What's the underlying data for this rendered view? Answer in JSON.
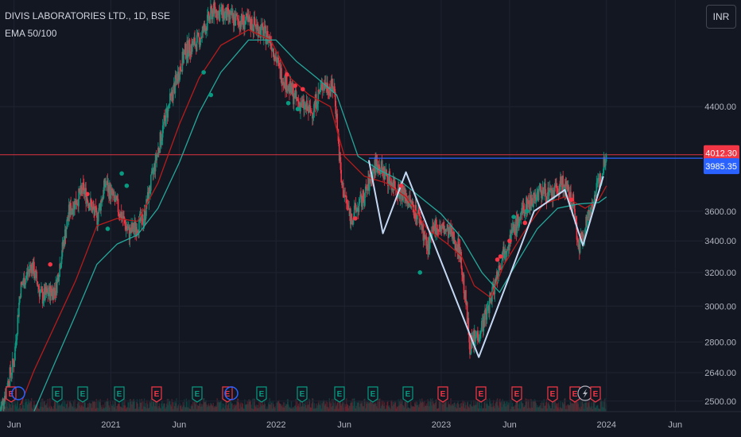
{
  "header": {
    "title": "DIVIS LABORATORIES LTD., 1D, BSE",
    "indicator": "EMA 50/100"
  },
  "currency": "INR",
  "price_labels": {
    "last": "4012.30",
    "level": "3985.35",
    "last_color": "#f23645",
    "level_color": "#2962ff"
  },
  "colors": {
    "up": "#089981",
    "down": "#f23645",
    "ema50": "#b71c1c",
    "ema100": "#26a69a",
    "pattern": "#c5d8f3",
    "level": "#2962ff"
  },
  "event_markers": [
    {
      "type": "E",
      "color": "#f23645"
    },
    {
      "type": "dividend",
      "color": "#2962ff"
    },
    {
      "type": "E",
      "color": "#089981"
    },
    {
      "type": "E",
      "color": "#089981"
    },
    {
      "type": "E",
      "color": "#089981"
    },
    {
      "type": "E",
      "color": "#f23645"
    },
    {
      "type": "E",
      "color": "#089981"
    },
    {
      "type": "E",
      "color": "#f23645"
    },
    {
      "type": "dividend",
      "color": "#2962ff"
    },
    {
      "type": "E",
      "color": "#089981"
    },
    {
      "type": "E",
      "color": "#089981"
    },
    {
      "type": "E",
      "color": "#089981"
    },
    {
      "type": "E",
      "color": "#089981"
    },
    {
      "type": "E",
      "color": "#089981"
    },
    {
      "type": "E",
      "color": "#f23645"
    },
    {
      "type": "E",
      "color": "#f23645"
    },
    {
      "type": "E",
      "color": "#f23645"
    },
    {
      "type": "E",
      "color": "#f23645"
    },
    {
      "type": "E",
      "color": "#f23645"
    },
    {
      "type": "flash",
      "color": "#b2b5be"
    },
    {
      "type": "E",
      "color": "#f23645"
    }
  ],
  "chart_data": {
    "type": "line",
    "subtype": "candlestick",
    "title": "DIVIS LABORATORIES LTD., 1D, BSE",
    "y_scale": "log",
    "y_range": [
      2450,
      5400
    ],
    "y_ticks": [
      "4400.00",
      "3600.00",
      "3400.00",
      "3200.00",
      "3000.00",
      "2800.00",
      "2640.00",
      "2500.00"
    ],
    "x_range": [
      "2020-05-01",
      "2024-08-01"
    ],
    "x_ticks": [
      {
        "label": "Jun",
        "date": "2020-06-01"
      },
      {
        "label": "2021",
        "date": "2021-01-01"
      },
      {
        "label": "Jun",
        "date": "2021-06-01"
      },
      {
        "label": "2022",
        "date": "2022-01-01"
      },
      {
        "label": "Jun",
        "date": "2022-06-01"
      },
      {
        "label": "2023",
        "date": "2023-01-01"
      },
      {
        "label": "Jun",
        "date": "2023-06-01"
      },
      {
        "label": "2024",
        "date": "2024-01-01"
      },
      {
        "label": "Jun",
        "date": "2024-06-01"
      }
    ],
    "price_path": [
      [
        "2020-05-01",
        2450
      ],
      [
        "2020-06-01",
        2700
      ],
      [
        "2020-06-15",
        3100
      ],
      [
        "2020-07-10",
        3250
      ],
      [
        "2020-08-01",
        3050
      ],
      [
        "2020-09-01",
        3100
      ],
      [
        "2020-10-01",
        3600
      ],
      [
        "2020-11-01",
        3750
      ],
      [
        "2020-12-01",
        3550
      ],
      [
        "2020-12-20",
        3800
      ],
      [
        "2021-01-20",
        3600
      ],
      [
        "2021-02-10",
        3450
      ],
      [
        "2021-03-15",
        3550
      ],
      [
        "2021-05-01",
        4300
      ],
      [
        "2021-06-15",
        4900
      ],
      [
        "2021-07-15",
        5000
      ],
      [
        "2021-08-15",
        5300
      ],
      [
        "2021-10-01",
        5200
      ],
      [
        "2021-11-15",
        5150
      ],
      [
        "2021-12-20",
        5000
      ],
      [
        "2022-01-10",
        4700
      ],
      [
        "2022-02-15",
        4450
      ],
      [
        "2022-03-20",
        4350
      ],
      [
        "2022-04-15",
        4600
      ],
      [
        "2022-05-10",
        4550
      ],
      [
        "2022-05-25",
        3800
      ],
      [
        "2022-06-15",
        3550
      ],
      [
        "2022-07-15",
        3700
      ],
      [
        "2022-08-10",
        3950
      ],
      [
        "2022-09-15",
        3800
      ],
      [
        "2022-10-15",
        3700
      ],
      [
        "2022-11-15",
        3550
      ],
      [
        "2022-12-01",
        3350
      ],
      [
        "2022-12-20",
        3500
      ],
      [
        "2023-01-20",
        3450
      ],
      [
        "2023-02-10",
        3350
      ],
      [
        "2023-02-25",
        3000
      ],
      [
        "2023-03-05",
        2780
      ],
      [
        "2023-03-25",
        2850
      ],
      [
        "2023-04-10",
        2950
      ],
      [
        "2023-05-01",
        3150
      ],
      [
        "2023-05-20",
        3350
      ],
      [
        "2023-06-15",
        3500
      ],
      [
        "2023-07-10",
        3650
      ],
      [
        "2023-08-10",
        3750
      ],
      [
        "2023-09-01",
        3700
      ],
      [
        "2023-09-25",
        3800
      ],
      [
        "2023-10-20",
        3650
      ],
      [
        "2023-11-01",
        3350
      ],
      [
        "2023-11-20",
        3550
      ],
      [
        "2023-12-05",
        3700
      ],
      [
        "2023-12-20",
        3850
      ],
      [
        "2024-01-01",
        4050
      ]
    ],
    "series": [
      {
        "name": "EMA 50",
        "points": [
          [
            "2020-06-15",
            2480
          ],
          [
            "2020-07-15",
            2650
          ],
          [
            "2020-09-01",
            2900
          ],
          [
            "2020-10-15",
            3150
          ],
          [
            "2020-12-01",
            3500
          ],
          [
            "2021-01-15",
            3550
          ],
          [
            "2021-03-01",
            3530
          ],
          [
            "2021-04-15",
            3800
          ],
          [
            "2021-06-01",
            4250
          ],
          [
            "2021-07-15",
            4650
          ],
          [
            "2021-09-01",
            4950
          ],
          [
            "2021-11-01",
            5100
          ],
          [
            "2021-12-20",
            5000
          ],
          [
            "2022-02-01",
            4650
          ],
          [
            "2022-03-15",
            4500
          ],
          [
            "2022-05-01",
            4400
          ],
          [
            "2022-06-01",
            4000
          ],
          [
            "2022-07-15",
            3850
          ],
          [
            "2022-09-01",
            3800
          ],
          [
            "2022-10-15",
            3700
          ],
          [
            "2022-12-01",
            3480
          ],
          [
            "2023-01-15",
            3380
          ],
          [
            "2023-02-15",
            3300
          ],
          [
            "2023-03-15",
            3120
          ],
          [
            "2023-04-20",
            3050
          ],
          [
            "2023-05-20",
            3250
          ],
          [
            "2023-07-01",
            3450
          ],
          [
            "2023-08-15",
            3650
          ],
          [
            "2023-10-01",
            3700
          ],
          [
            "2023-11-15",
            3620
          ],
          [
            "2023-12-15",
            3680
          ],
          [
            "2024-01-01",
            3780
          ]
        ]
      },
      {
        "name": "EMA 100",
        "points": [
          [
            "2020-07-15",
            2450
          ],
          [
            "2020-09-01",
            2700
          ],
          [
            "2020-10-15",
            2950
          ],
          [
            "2020-12-01",
            3250
          ],
          [
            "2021-01-15",
            3380
          ],
          [
            "2021-03-01",
            3440
          ],
          [
            "2021-04-15",
            3620
          ],
          [
            "2021-06-01",
            3950
          ],
          [
            "2021-07-15",
            4350
          ],
          [
            "2021-09-01",
            4700
          ],
          [
            "2021-11-01",
            5000
          ],
          [
            "2022-01-01",
            5000
          ],
          [
            "2022-02-15",
            4800
          ],
          [
            "2022-04-01",
            4650
          ],
          [
            "2022-05-15",
            4500
          ],
          [
            "2022-07-01",
            4000
          ],
          [
            "2022-08-15",
            3900
          ],
          [
            "2022-10-01",
            3820
          ],
          [
            "2022-11-15",
            3700
          ],
          [
            "2023-01-01",
            3580
          ],
          [
            "2023-02-15",
            3420
          ],
          [
            "2023-04-01",
            3200
          ],
          [
            "2023-05-10",
            3080
          ],
          [
            "2023-06-15",
            3250
          ],
          [
            "2023-08-01",
            3480
          ],
          [
            "2023-09-15",
            3620
          ],
          [
            "2023-11-01",
            3650
          ],
          [
            "2023-12-15",
            3660
          ],
          [
            "2024-01-01",
            3700
          ]
        ]
      }
    ],
    "pattern_path": [
      [
        "2022-07-25",
        3970
      ],
      [
        "2022-08-25",
        3450
      ],
      [
        "2022-10-15",
        3880
      ],
      [
        "2023-03-25",
        2720
      ],
      [
        "2023-07-25",
        3600
      ],
      [
        "2023-10-01",
        3750
      ],
      [
        "2023-11-10",
        3370
      ],
      [
        "2023-12-25",
        3850
      ]
    ],
    "resistance": {
      "value": 3985.35,
      "from": "2022-07-25",
      "to": "2024-01-01"
    },
    "last_price": 4012.3
  }
}
